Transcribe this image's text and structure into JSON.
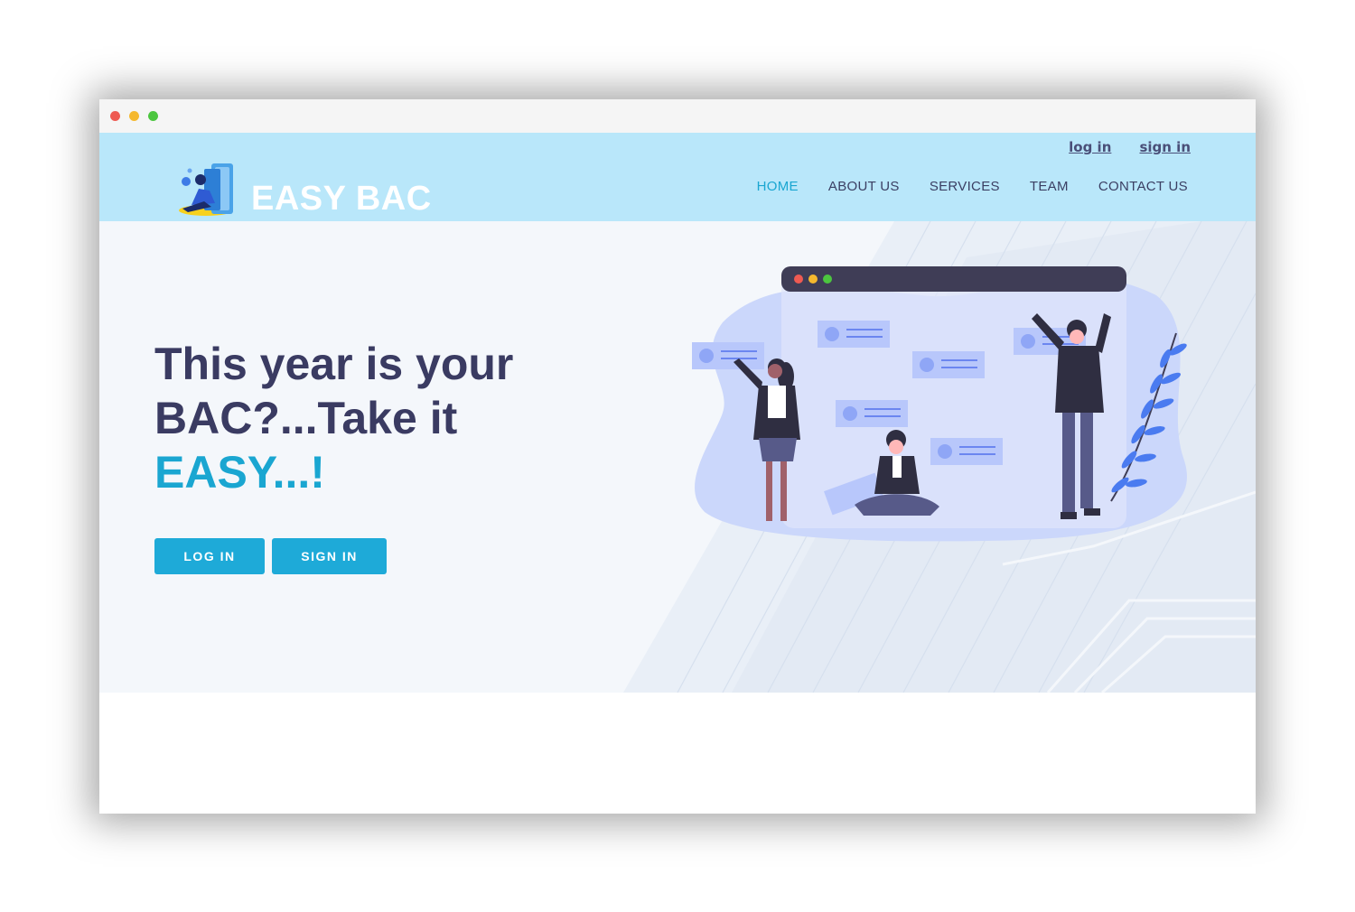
{
  "brand": {
    "name": "EASY BAC",
    "logo_icon": "student-reading-books-icon"
  },
  "auth": {
    "login_link": "log in",
    "signin_link": "sign in"
  },
  "nav": {
    "items": [
      {
        "label": "HOME",
        "active": true
      },
      {
        "label": "ABOUT US",
        "active": false
      },
      {
        "label": "SERVICES",
        "active": false
      },
      {
        "label": "TEAM",
        "active": false
      },
      {
        "label": "CONTACT US",
        "active": false
      }
    ]
  },
  "hero": {
    "headline_line1": "This year is your",
    "headline_line2": "BAC?...Take it",
    "headline_accent": "EASY...!",
    "login_button": "LOG IN",
    "signin_button": "SIGN IN"
  },
  "colors": {
    "header_bg": "#b9e7fa",
    "accent": "#1aa6d1",
    "button": "#1eaad8",
    "headline": "#3a3b62",
    "hero_bg": "#f4f7fb"
  }
}
